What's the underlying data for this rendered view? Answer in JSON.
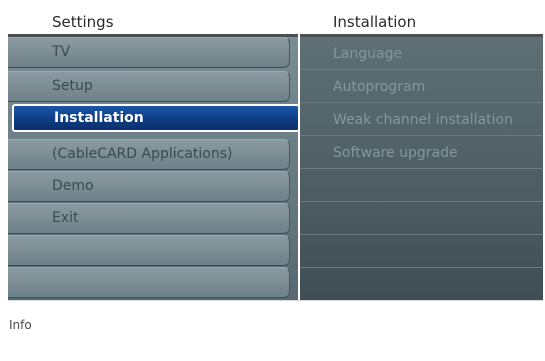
{
  "left_header": "Settings",
  "right_header": "Installation",
  "menu": {
    "items": [
      {
        "label": "TV"
      },
      {
        "label": "Setup"
      },
      {
        "label": "Installation"
      },
      {
        "label": "(CableCARD Applications)"
      },
      {
        "label": "Demo"
      },
      {
        "label": "Exit"
      },
      {
        "label": ""
      },
      {
        "label": ""
      }
    ],
    "selected_index": 2
  },
  "submenu": {
    "items": [
      {
        "label": "Language"
      },
      {
        "label": "Autoprogram"
      },
      {
        "label": "Weak channel installation"
      },
      {
        "label": "Software upgrade"
      },
      {
        "label": ""
      },
      {
        "label": ""
      },
      {
        "label": ""
      },
      {
        "label": ""
      }
    ]
  },
  "info_label": "Info",
  "colors": {
    "selected_bg": "#0f3d84",
    "menu_bg": "#7b8c93",
    "submenu_bg": "#4c5c62"
  }
}
